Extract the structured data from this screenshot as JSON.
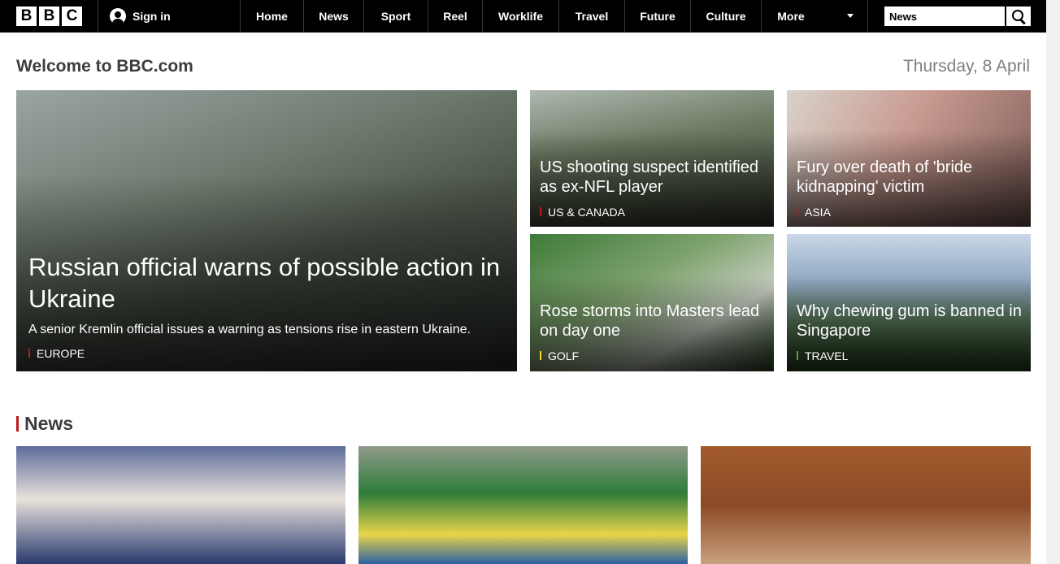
{
  "nav": {
    "logo_letters": [
      "B",
      "B",
      "C"
    ],
    "signin_label": "Sign in",
    "items": [
      "Home",
      "News",
      "Sport",
      "Reel",
      "Worklife",
      "Travel",
      "Future",
      "Culture",
      "More"
    ],
    "search_value": "News"
  },
  "header": {
    "welcome": "Welcome to BBC.com",
    "date": "Thursday, 8 April"
  },
  "top_stories": [
    {
      "headline": "Russian official warns of possible action in Ukraine",
      "summary": "A senior Kremlin official issues a warning as tensions rise in eastern Ukraine.",
      "tag": "EUROPE",
      "tag_color": "#bb1919"
    },
    {
      "headline": "US shooting suspect identified as ex-NFL player",
      "tag": "US & CANADA",
      "tag_color": "#bb1919"
    },
    {
      "headline": "Fury over death of 'bride kidnapping' victim",
      "tag": "ASIA",
      "tag_color": "#bb1919"
    },
    {
      "headline": "Rose storms into Masters lead on day one",
      "tag": "GOLF",
      "tag_color": "#ffd230"
    },
    {
      "headline": "Why chewing gum is banned in Singapore",
      "tag": "TRAVEL",
      "tag_color": "#589e50"
    }
  ],
  "news_section": {
    "title": "News",
    "accent": "#bb1919"
  }
}
